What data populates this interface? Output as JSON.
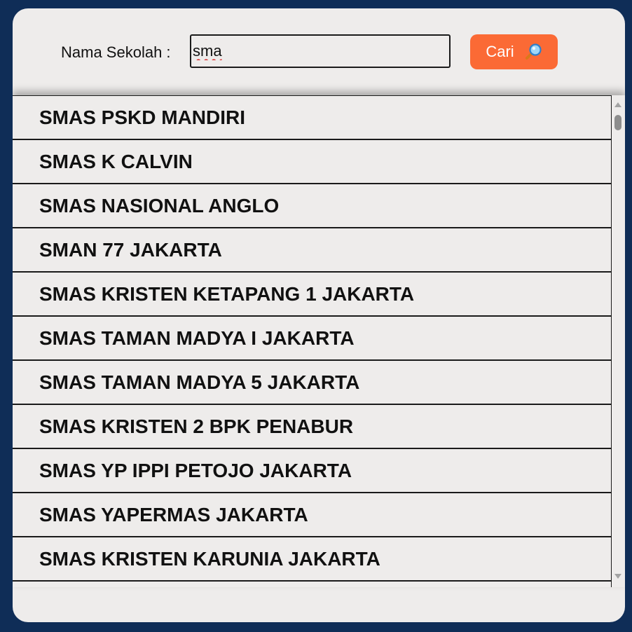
{
  "search": {
    "label": "Nama Sekolah :",
    "value": "sma",
    "button_label": "Cari",
    "button_icon": "magnifier-icon"
  },
  "results": [
    "SMAS PSKD MANDIRI",
    "SMAS K CALVIN",
    "SMAS NASIONAL ANGLO",
    "SMAN 77 JAKARTA",
    "SMAS KRISTEN KETAPANG 1 JAKARTA",
    "SMAS TAMAN MADYA I JAKARTA",
    "SMAS TAMAN MADYA 5 JAKARTA",
    "SMAS KRISTEN 2 BPK PENABUR",
    "SMAS YP IPPI PETOJO JAKARTA",
    "SMAS YAPERMAS JAKARTA",
    "SMAS KRISTEN KARUNIA JAKARTA",
    ""
  ],
  "colors": {
    "background": "#0f2d57",
    "panel": "#eeeceb",
    "button": "#fb6a35",
    "button_text": "#ffffff"
  }
}
